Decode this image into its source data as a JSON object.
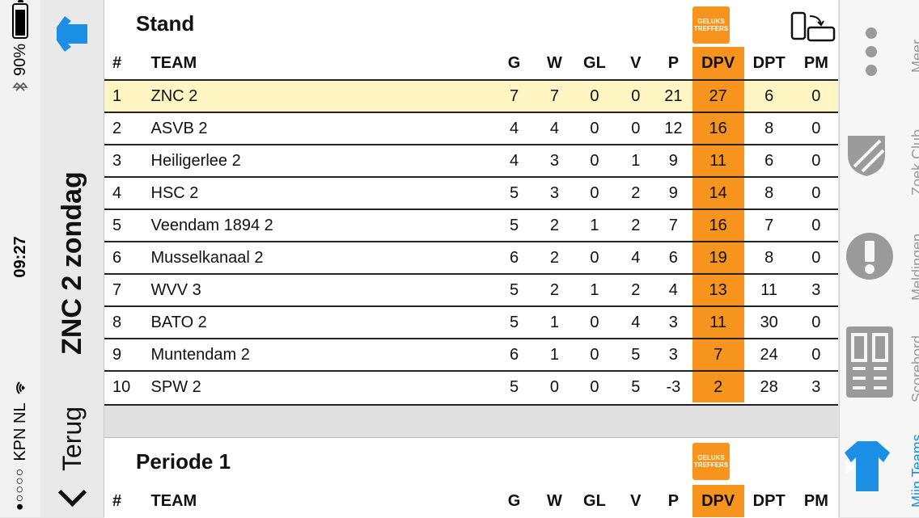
{
  "status": {
    "carrier": "KPN NL",
    "signal_dots": "●○○○○",
    "time": "09:27",
    "battery_percent": "90%",
    "battery_level": 0.9
  },
  "nav": {
    "back_label": "Terug",
    "title": "ZNC 2 zondag"
  },
  "stand": {
    "title": "Stand",
    "logo_text_1": "GELUKS",
    "logo_text_2": "TREFFERS",
    "columns": [
      "#",
      "TEAM",
      "G",
      "W",
      "GL",
      "V",
      "P",
      "DPV",
      "DPT",
      "PM"
    ],
    "rows": [
      [
        "1",
        "ZNC 2",
        "7",
        "7",
        "0",
        "0",
        "21",
        "27",
        "6",
        "0"
      ],
      [
        "2",
        "ASVB 2",
        "4",
        "4",
        "0",
        "0",
        "12",
        "16",
        "8",
        "0"
      ],
      [
        "3",
        "Heiligerlee 2",
        "4",
        "3",
        "0",
        "1",
        "9",
        "11",
        "6",
        "0"
      ],
      [
        "4",
        "HSC 2",
        "5",
        "3",
        "0",
        "2",
        "9",
        "14",
        "8",
        "0"
      ],
      [
        "5",
        "Veendam 1894 2",
        "5",
        "2",
        "1",
        "2",
        "7",
        "16",
        "7",
        "0"
      ],
      [
        "6",
        "Musselkanaal 2",
        "6",
        "2",
        "0",
        "4",
        "6",
        "19",
        "8",
        "0"
      ],
      [
        "7",
        "WVV 3",
        "5",
        "2",
        "1",
        "2",
        "4",
        "13",
        "11",
        "3"
      ],
      [
        "8",
        "BATO 2",
        "5",
        "1",
        "0",
        "4",
        "3",
        "11",
        "30",
        "0"
      ],
      [
        "9",
        "Muntendam 2",
        "6",
        "1",
        "0",
        "5",
        "3",
        "7",
        "24",
        "0"
      ],
      [
        "10",
        "SPW 2",
        "5",
        "0",
        "0",
        "5",
        "-3",
        "2",
        "28",
        "3"
      ]
    ]
  },
  "periode": {
    "title": "Periode 1",
    "logo_text_1": "GELUKS",
    "logo_text_2": "TREFFERS",
    "columns": [
      "#",
      "TEAM",
      "G",
      "W",
      "GL",
      "V",
      "P",
      "DPV",
      "DPT",
      "PM"
    ]
  },
  "tabs": [
    {
      "label": "Meer",
      "icon": "more-dots-icon",
      "active": false
    },
    {
      "label": "Zoek Club",
      "icon": "club-shield-icon",
      "active": false
    },
    {
      "label": "Meldingen",
      "icon": "alert-icon",
      "active": false
    },
    {
      "label": "Scorebord",
      "icon": "scoreboard-icon",
      "active": false
    },
    {
      "label": "Mijn Teams",
      "icon": "shirt-icon",
      "active": true
    }
  ],
  "colors": {
    "accent_orange": "#f7941d",
    "highlight_row": "#fff6c4",
    "active_blue": "#1a8fe3",
    "inactive_gray": "#9a9a9a"
  }
}
